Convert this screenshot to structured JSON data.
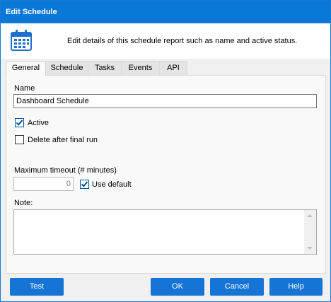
{
  "window": {
    "title": "Edit Schedule"
  },
  "header": {
    "icon": "calendar-icon",
    "description": "Edit details of this schedule report such as name and active status."
  },
  "tabs": [
    {
      "label": "General",
      "active": true
    },
    {
      "label": "Schedule",
      "active": false
    },
    {
      "label": "Tasks",
      "active": false
    },
    {
      "label": "Events",
      "active": false
    },
    {
      "label": "API",
      "active": false
    }
  ],
  "general": {
    "name_label": "Name",
    "name_value": "Dashboard Schedule",
    "active_label": "Active",
    "active_checked": true,
    "delete_label": "Delete after final run",
    "delete_checked": false,
    "timeout_label": "Maximum timeout (# minutes)",
    "timeout_value": "0",
    "use_default_label": "Use default",
    "use_default_checked": true,
    "note_label": "Note:",
    "note_value": ""
  },
  "buttons": {
    "test": "Test",
    "ok": "OK",
    "cancel": "Cancel",
    "help": "Help"
  },
  "colors": {
    "titlebar": "#0a78d7",
    "button": "#1574d4",
    "checkbox_check": "#005499"
  }
}
